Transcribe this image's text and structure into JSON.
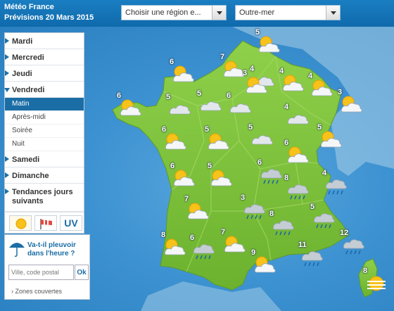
{
  "header": {
    "title": "Météo France",
    "subtitle": "Prévisions 20 Mars 2015",
    "region_select": "Choisir une région e...",
    "outremer_select": "Outre-mer"
  },
  "sidebar": {
    "days": [
      {
        "label": "Mardi"
      },
      {
        "label": "Mercredi"
      },
      {
        "label": "Jeudi"
      },
      {
        "label": "Vendredi"
      }
    ],
    "periods": [
      "Matin",
      "Après-midi",
      "Soirée",
      "Nuit"
    ],
    "active_period": "Matin",
    "days_after": [
      {
        "label": "Samedi"
      },
      {
        "label": "Dimanche"
      }
    ],
    "trends": "Tendances jours suivants",
    "uv_label": "UV"
  },
  "rain": {
    "question": "Va-t-il pleuvoir dans l'heure ?",
    "placeholder": "Ville, code postal",
    "ok": "Ok",
    "zones": "› Zones couvertes"
  },
  "colors": {
    "header_bg": "#1274b8",
    "sea": "#3d92d1",
    "land": "#7cc13a",
    "active_period_bg": "#1b6da5"
  },
  "map": {
    "forecasts": [
      {
        "temp": "5",
        "icon": "sun-cloud-icon"
      },
      {
        "temp": "6",
        "icon": "sun-cloud-icon"
      },
      {
        "temp": "7",
        "icon": "sun-cloud-icon"
      },
      {
        "temp": "4",
        "icon": "cloud-icon"
      },
      {
        "temp": "4",
        "icon": "sun-cloud-icon"
      },
      {
        "temp": "4",
        "icon": "sun-cloud-icon"
      },
      {
        "temp": "6",
        "icon": "sun-cloud-icon"
      },
      {
        "temp": "5",
        "icon": "cloud-icon"
      },
      {
        "temp": "5",
        "icon": "cloud-icon"
      },
      {
        "temp": "6",
        "icon": "cloud-icon"
      },
      {
        "temp": "3",
        "icon": "sun-cloud-icon"
      },
      {
        "temp": "3",
        "icon": "sun-cloud-icon"
      },
      {
        "temp": "6",
        "icon": "sun-cloud-icon"
      },
      {
        "temp": "5",
        "icon": "sun-cloud-icon"
      },
      {
        "temp": "5",
        "icon": "cloud-icon"
      },
      {
        "temp": "4",
        "icon": "cloud-icon"
      },
      {
        "temp": "5",
        "icon": "sun-cloud-icon"
      },
      {
        "temp": "6",
        "icon": "sun-cloud-icon"
      },
      {
        "temp": "6",
        "icon": "rain-icon"
      },
      {
        "temp": "5",
        "icon": "sun-cloud-icon"
      },
      {
        "temp": "6",
        "icon": "sun-cloud-icon"
      },
      {
        "temp": "8",
        "icon": "rain-icon"
      },
      {
        "temp": "4",
        "icon": "rain-icon"
      },
      {
        "temp": "7",
        "icon": "sun-cloud-icon"
      },
      {
        "temp": "3",
        "icon": "rain-icon"
      },
      {
        "temp": "5",
        "icon": "rain-icon"
      },
      {
        "temp": "8",
        "icon": "rain-icon"
      },
      {
        "temp": "8",
        "icon": "sun-cloud-icon"
      },
      {
        "temp": "6",
        "icon": "rain-icon"
      },
      {
        "temp": "7",
        "icon": "sun-cloud-icon"
      },
      {
        "temp": "12",
        "icon": "rain-icon"
      },
      {
        "temp": "11",
        "icon": "rain-icon"
      },
      {
        "temp": "9",
        "icon": "sun-cloud-icon"
      },
      {
        "temp": "8",
        "icon": "sun-fog-icon"
      }
    ]
  }
}
